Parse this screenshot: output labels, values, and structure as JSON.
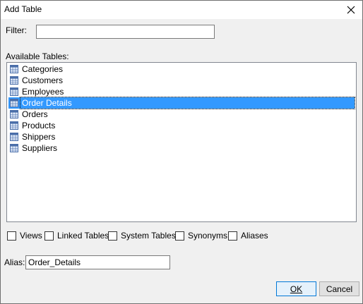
{
  "window": {
    "title": "Add Table"
  },
  "filter": {
    "label": "Filter:",
    "value": ""
  },
  "available": {
    "label": "Available Tables:",
    "items": [
      "Categories",
      "Customers",
      "Employees",
      "Order Details",
      "Orders",
      "Products",
      "Shippers",
      "Suppliers"
    ],
    "selected": "Order Details"
  },
  "options": {
    "views": "Views",
    "linked_tables": "Linked Tables",
    "system_tables": "System Tables",
    "synonyms": "Synonyms",
    "aliases": "Aliases"
  },
  "alias": {
    "label": "Alias:",
    "value": "Order_Details"
  },
  "buttons": {
    "ok": "OK",
    "cancel": "Cancel"
  },
  "colors": {
    "selection": "#3399ff",
    "accent": "#0078d7"
  }
}
